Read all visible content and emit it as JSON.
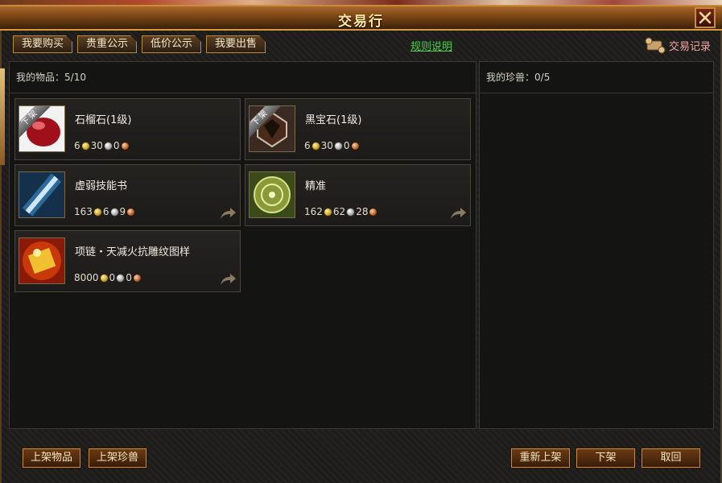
{
  "window": {
    "title": "交易行"
  },
  "tabs": [
    {
      "label": "我要购买"
    },
    {
      "label": "贵重公示"
    },
    {
      "label": "低价公示"
    },
    {
      "label": "我要出售"
    }
  ],
  "rules_link": "规则说明",
  "trade_record": "交易记录",
  "items_panel": {
    "header_label": "我的物品：",
    "count": "5/10",
    "items": [
      {
        "name": "石榴石(1级)",
        "status": "下架",
        "icon": "red-gem-icon",
        "gold": "6",
        "silver": "30",
        "copper": "0",
        "shareable": false
      },
      {
        "name": "黑宝石(1级)",
        "status": "下架",
        "icon": "black-gem-icon",
        "gold": "6",
        "silver": "30",
        "copper": "0",
        "shareable": false
      },
      {
        "name": "虚弱技能书",
        "status": "",
        "icon": "skill-book-icon",
        "gold": "163",
        "silver": "6",
        "copper": "9",
        "shareable": true
      },
      {
        "name": "精准",
        "status": "",
        "icon": "target-disc-icon",
        "gold": "162",
        "silver": "62",
        "copper": "28",
        "shareable": true
      },
      {
        "name": "项链・天减火抗雕纹图样",
        "status": "",
        "icon": "pattern-scroll-icon",
        "gold": "8000",
        "silver": "0",
        "copper": "0",
        "shareable": true
      }
    ]
  },
  "pets_panel": {
    "header_label": "我的珍兽：",
    "count": "0/5"
  },
  "buttons": {
    "list_item": "上架物品",
    "list_pet": "上架珍兽",
    "relist": "重新上架",
    "delist": "下架",
    "cancel": "取回"
  },
  "colors": {
    "rules_link": "#4cd04a",
    "trade_record": "#f0a8a8",
    "title": "#ffe69a"
  }
}
